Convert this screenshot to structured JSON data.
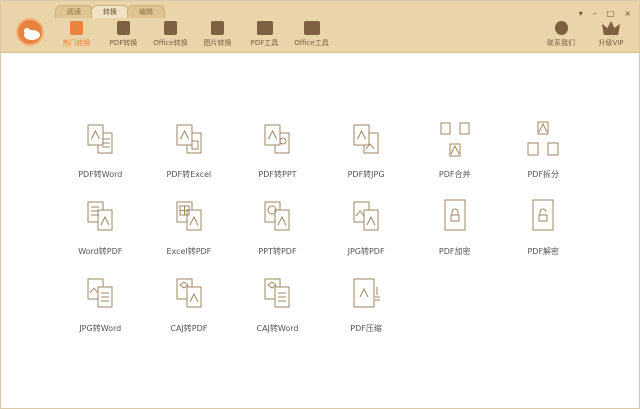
{
  "tabs": [
    {
      "label": "阅读"
    },
    {
      "label": "转换"
    },
    {
      "label": "编辑"
    }
  ],
  "nav": [
    {
      "label": "热门转换"
    },
    {
      "label": "PDF转换"
    },
    {
      "label": "Office转换"
    },
    {
      "label": "图片转换"
    },
    {
      "label": "PDF工具"
    },
    {
      "label": "Office工具"
    }
  ],
  "right": [
    {
      "label": "联系我们"
    },
    {
      "label": "升级VIP"
    }
  ],
  "window_controls": {
    "menu": "▾",
    "minimize": "–",
    "maximize": "□",
    "close": "×"
  },
  "tools": [
    {
      "label": "PDF转Word",
      "icon": "pdf-to-word"
    },
    {
      "label": "PDF转Excel",
      "icon": "pdf-to-excel"
    },
    {
      "label": "PDF转PPT",
      "icon": "pdf-to-ppt"
    },
    {
      "label": "PDF转JPG",
      "icon": "pdf-to-jpg"
    },
    {
      "label": "PDF合并",
      "icon": "pdf-merge"
    },
    {
      "label": "PDF拆分",
      "icon": "pdf-split"
    },
    {
      "label": "Word转PDF",
      "icon": "word-to-pdf"
    },
    {
      "label": "Excel转PDF",
      "icon": "excel-to-pdf"
    },
    {
      "label": "PPT转PDF",
      "icon": "ppt-to-pdf"
    },
    {
      "label": "JPG转PDF",
      "icon": "jpg-to-pdf"
    },
    {
      "label": "PDF加密",
      "icon": "pdf-encrypt"
    },
    {
      "label": "PDF解密",
      "icon": "pdf-decrypt"
    },
    {
      "label": "JPG转Word",
      "icon": "jpg-to-word"
    },
    {
      "label": "CAJ转PDF",
      "icon": "caj-to-pdf"
    },
    {
      "label": "CAJ转Word",
      "icon": "caj-to-word"
    },
    {
      "label": "PDF压缩",
      "icon": "pdf-compress"
    }
  ],
  "colors": {
    "accent": "#e8843e",
    "header": "#ead5ab",
    "icon": "#a08660"
  }
}
